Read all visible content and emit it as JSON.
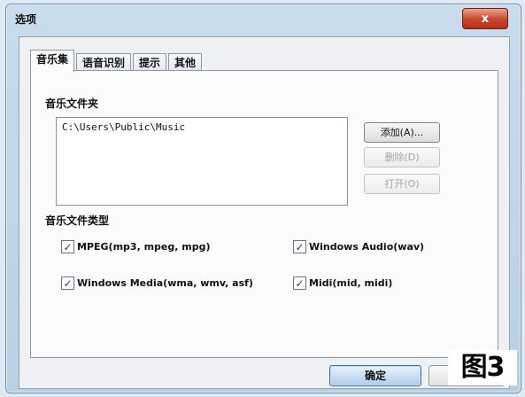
{
  "window": {
    "title": "选项",
    "close_label": "x"
  },
  "tabs": [
    {
      "label": "音乐集",
      "active": true
    },
    {
      "label": "语音识别",
      "active": false
    },
    {
      "label": "提示",
      "active": false
    },
    {
      "label": "其他",
      "active": false
    }
  ],
  "music_folders": {
    "section_title": "音乐文件夹",
    "items": [
      "C:\\Users\\Public\\Music"
    ],
    "add_button": "添加(A)...",
    "remove_button": "删除(D)",
    "open_button": "打开(O)"
  },
  "file_types": {
    "section_title": "音乐文件类型",
    "options": [
      {
        "label": "MPEG(mp3, mpeg, mpg)",
        "checked": true
      },
      {
        "label": "Windows Audio(wav)",
        "checked": true
      },
      {
        "label": "Windows Media(wma, wmv, asf)",
        "checked": true
      },
      {
        "label": "Midi(mid, midi)",
        "checked": true
      }
    ]
  },
  "footer": {
    "ok_button": "确定",
    "figure_label": "图3"
  },
  "colors": {
    "accent": "#3e6aa3",
    "close_button": "#c5452a"
  }
}
